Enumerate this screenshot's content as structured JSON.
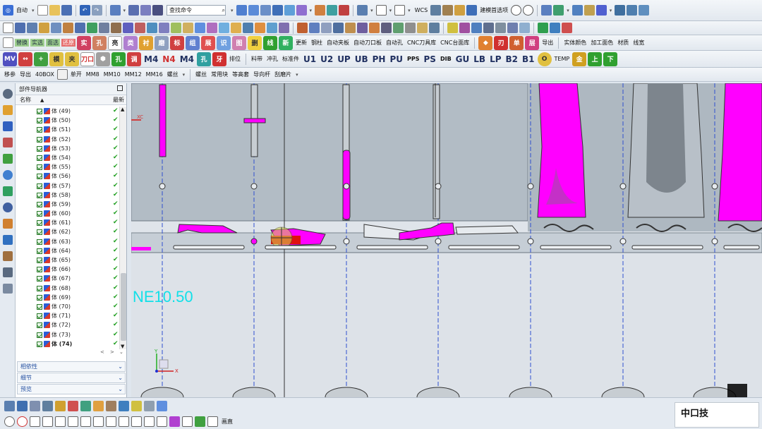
{
  "toolbar1": {
    "menu_label": "自动",
    "search_placeholder": "查找命令",
    "right_label": "建模首选项"
  },
  "toolbar2": {
    "labels": [
      "替换",
      "实选",
      "面选",
      "还原",
      "自动实例",
      "自动实例孔",
      "高亮显示",
      "类型",
      "轴衬",
      "磨削",
      "自动标注",
      "特征组",
      "展开",
      "标识",
      "图标",
      "删除",
      "辅助线",
      "更新",
      "钢柱",
      "自动夹板",
      "自动刀口板",
      "自动孔",
      "CNC刀具库",
      "CNC台面库",
      "导出",
      "实体颜色",
      "加工面色",
      "材质",
      "线宽"
    ]
  },
  "toolbar3": {
    "labels": [
      "MV",
      "U1",
      "U2",
      "UP",
      "UB",
      "PH",
      "PU",
      "PPS",
      "PS",
      "DIB",
      "GU",
      "LB",
      "LP",
      "B2",
      "B1",
      "TEMP",
      "M4",
      "N4",
      "M4",
      "料带",
      "冲孔",
      "标准件",
      "调",
      "孔",
      "牙",
      "排位",
      "刀口"
    ]
  },
  "toolbar4": {
    "labels": [
      "移参",
      "导出",
      "40BOX",
      "单开",
      "MM8",
      "MM10",
      "MM12",
      "MM16",
      "螺丝",
      "常用块",
      "等高套",
      "导向杆",
      "刮磨片"
    ]
  },
  "navigator": {
    "title": "部件导航器",
    "col_name": "名称",
    "col_latest": "最新",
    "items": [
      "体 (49)",
      "体 (50)",
      "体 (51)",
      "体 (52)",
      "体 (53)",
      "体 (54)",
      "体 (55)",
      "体 (56)",
      "体 (57)",
      "体 (58)",
      "体 (59)",
      "体 (60)",
      "体 (61)",
      "体 (62)",
      "体 (63)",
      "体 (64)",
      "体 (65)",
      "体 (66)",
      "体 (67)",
      "体 (68)",
      "体 (69)",
      "体 (70)",
      "体 (71)",
      "体 (72)",
      "体 (73)",
      "体 (74)"
    ],
    "check_icon": "check-icon",
    "sections": [
      "相依性",
      "细节",
      "预览"
    ]
  },
  "viewport": {
    "big_text": "NE10.50",
    "small_label": "XC",
    "axis_x": "X",
    "axis_y": "Y",
    "highlight_color": "#ff00ff",
    "part_color": "#a9b3bc",
    "strip_color": "#c9d1d9"
  },
  "bottom": {
    "label": "画直"
  },
  "brand": {
    "name": "中口技"
  }
}
